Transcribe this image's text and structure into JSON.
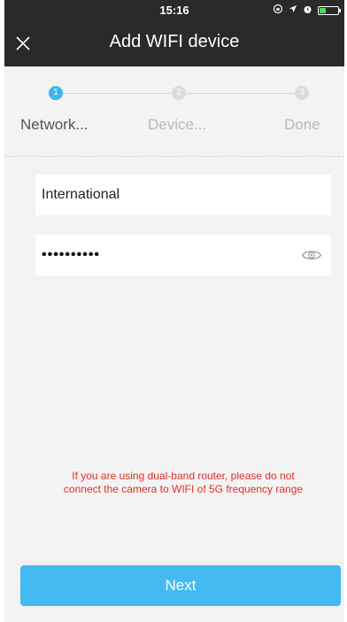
{
  "status_bar": {
    "time": "15:16",
    "icons": [
      "lock-rotation-icon",
      "location-arrow-icon",
      "alarm-icon",
      "battery-icon"
    ]
  },
  "nav": {
    "title": "Add WIFI device",
    "close_icon": "close-icon"
  },
  "stepper": {
    "steps": [
      {
        "number": "1",
        "label": "Network...",
        "state": "active"
      },
      {
        "number": "2",
        "label": "Device...",
        "state": "inactive"
      },
      {
        "number": "3",
        "label": "Done",
        "state": "inactive"
      }
    ]
  },
  "form": {
    "ssid_value": "International",
    "password_mask": "••••••••••",
    "password_toggle_icon": "eye-icon"
  },
  "warning": {
    "line1": "If you are using dual-band router, please do not",
    "line2": "connect the camera to WIFI of 5G frequency range"
  },
  "next_button": {
    "label": "Next"
  },
  "colors": {
    "header_bg": "#2a2a2a",
    "accent": "#45baf2",
    "warning": "#e0302b",
    "step_active": "#3cb4ee"
  }
}
